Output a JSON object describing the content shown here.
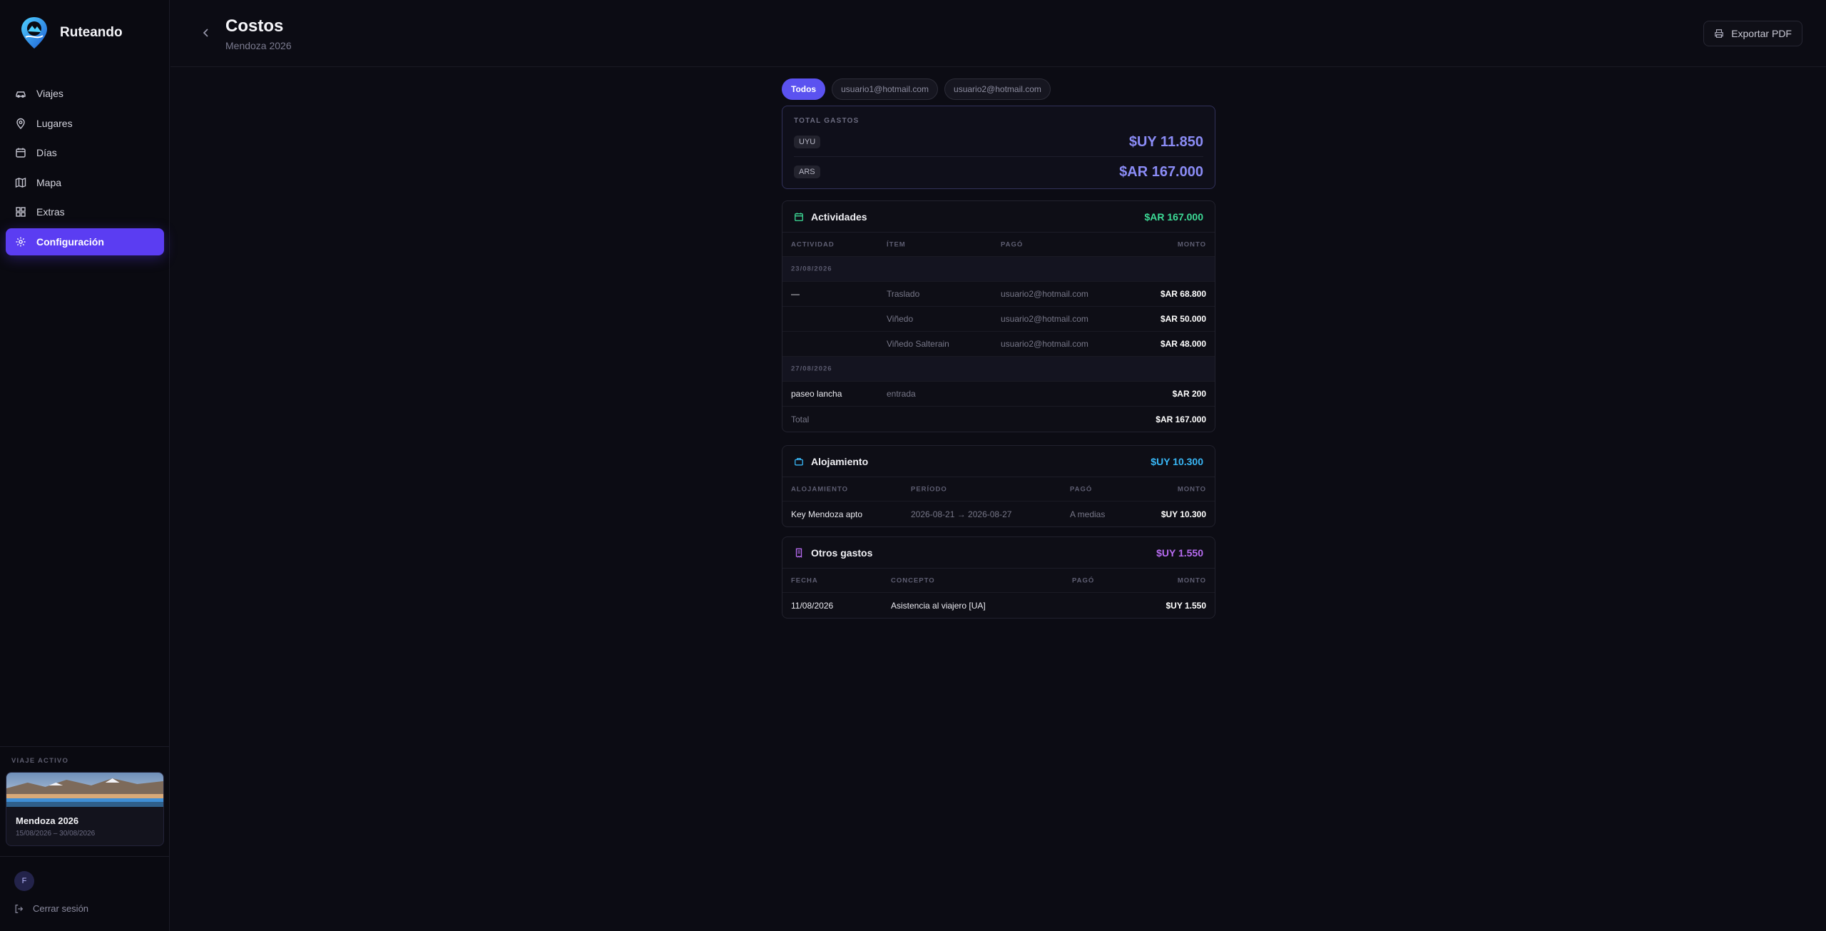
{
  "app": {
    "name": "Ruteando"
  },
  "sidebar": {
    "items": [
      {
        "label": "Viajes",
        "icon": "car-icon"
      },
      {
        "label": "Lugares",
        "icon": "map-pin-icon"
      },
      {
        "label": "Días",
        "icon": "calendar-icon"
      },
      {
        "label": "Mapa",
        "icon": "map-icon"
      },
      {
        "label": "Extras",
        "icon": "grid-icon"
      },
      {
        "label": "Configuración",
        "icon": "gear-icon",
        "active": true
      }
    ],
    "active_trip_label": "VIAJE ACTIVO",
    "active_trip": {
      "name": "Mendoza 2026",
      "dates": "15/08/2026 – 30/08/2026"
    },
    "user_initial": "F",
    "logout_label": "Cerrar sesión"
  },
  "header": {
    "title": "Costos",
    "subtitle": "Mendoza 2026",
    "export_label": "Exportar PDF"
  },
  "filters": [
    "Todos",
    "usuario1@hotmail.com",
    "usuario2@hotmail.com"
  ],
  "totals": {
    "label": "TOTAL GASTOS",
    "rows": [
      {
        "currency": "UYU",
        "value": "$UY 11.850"
      },
      {
        "currency": "ARS",
        "value": "$AR 167.000"
      }
    ]
  },
  "activities": {
    "title": "Actividades",
    "total": "$AR 167.000",
    "headers": [
      "ACTIVIDAD",
      "ÍTEM",
      "PAGÓ",
      "MONTO"
    ],
    "groups": [
      {
        "date": "23/08/2026",
        "rows": [
          {
            "activity": "—",
            "item": "Traslado",
            "payer": "usuario2@hotmail.com",
            "amount": "$AR 68.800"
          },
          {
            "activity": "",
            "item": "Viñedo",
            "payer": "usuario2@hotmail.com",
            "amount": "$AR 50.000"
          },
          {
            "activity": "",
            "item": "Viñedo Salterain",
            "payer": "usuario2@hotmail.com",
            "amount": "$AR 48.000"
          }
        ]
      },
      {
        "date": "27/08/2026",
        "rows": [
          {
            "activity": "paseo lancha",
            "item": "entrada",
            "payer": "",
            "amount": "$AR 200"
          }
        ]
      }
    ],
    "total_label": "Total",
    "total_value": "$AR 167.000"
  },
  "lodging": {
    "title": "Alojamiento",
    "total": "$UY 10.300",
    "headers": [
      "ALOJAMIENTO",
      "PERÍODO",
      "PAGÓ",
      "MONTO"
    ],
    "rows": [
      {
        "name": "Key Mendoza apto",
        "period": "2026-08-21 → 2026-08-27",
        "payer": "A medias",
        "amount": "$UY 10.300"
      }
    ]
  },
  "other": {
    "title": "Otros gastos",
    "total": "$UY 1.550",
    "headers": [
      "FECHA",
      "CONCEPTO",
      "PAGÓ",
      "MONTO"
    ],
    "rows": [
      {
        "date": "11/08/2026",
        "concept": "Asistencia al viajero [UA]",
        "payer": "",
        "amount": "$UY 1.550"
      }
    ]
  },
  "colors": {
    "accent": "#5b3df2",
    "activities_total": "#3ddc97",
    "lodging_total": "#38b6f5",
    "other_total": "#b86cf2",
    "grand_total": "#8b8cf6"
  }
}
